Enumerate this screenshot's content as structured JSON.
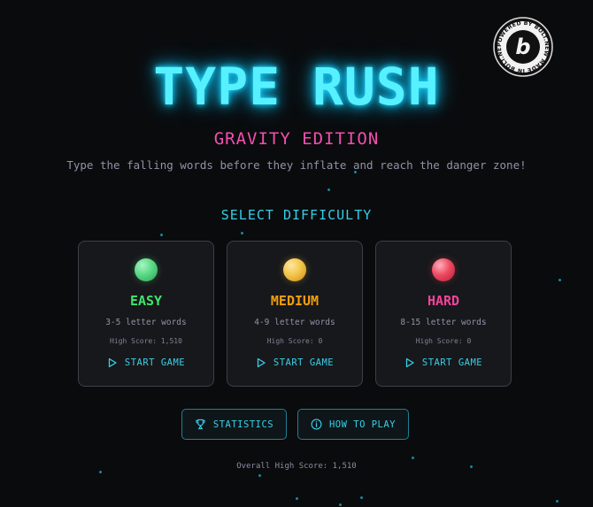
{
  "badge": {
    "ring_text": "POWERED BY BOLT.NEW MADE IN BOLT.NEW ",
    "logo": "b"
  },
  "header": {
    "title": "TYPE RUSH",
    "subtitle": "GRAVITY EDITION",
    "tagline": "Type the falling words before they inflate and reach the danger zone!"
  },
  "difficulty": {
    "heading": "SELECT DIFFICULTY",
    "cards": [
      {
        "name": "EASY",
        "description": "3-5 letter words",
        "high_score": "High Score: 1,510",
        "start_label": "START GAME",
        "color": "#3ee66a",
        "orb_color": "#59d985"
      },
      {
        "name": "MEDIUM",
        "description": "4-9 letter words",
        "high_score": "High Score: 0",
        "start_label": "START GAME",
        "color": "#f59e0b",
        "orb_color": "#f4c54a"
      },
      {
        "name": "HARD",
        "description": "8-15 letter words",
        "high_score": "High Score: 0",
        "start_label": "START GAME",
        "color": "#f0439b",
        "orb_color": "#ee4a62"
      }
    ]
  },
  "actions": {
    "statistics_label": "STATISTICS",
    "how_to_play_label": "HOW TO PLAY"
  },
  "footer": {
    "overall_high_score": "Overall High Score: 1,510"
  },
  "colors": {
    "accent_cyan": "#39cfe8",
    "subtitle_pink": "#f24fb0",
    "background": "#0a0b0d"
  }
}
